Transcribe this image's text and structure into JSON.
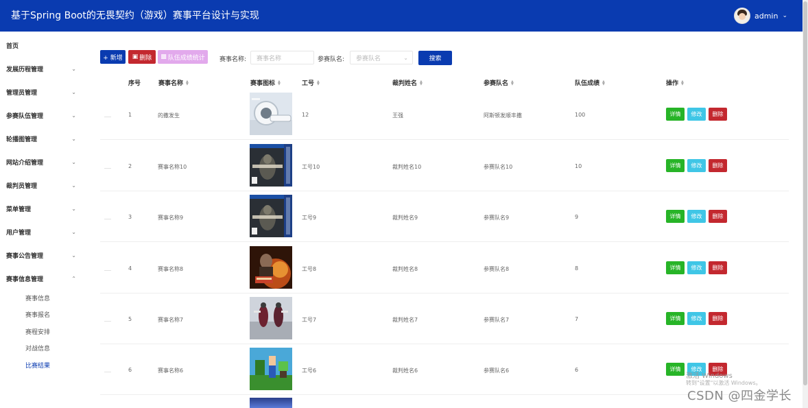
{
  "header": {
    "title": "基于Spring Boot的无畏契约（游戏）赛事平台设计与实现",
    "username": "admin"
  },
  "sidebar": {
    "items": [
      {
        "label": "首页"
      },
      {
        "label": "发展历程管理"
      },
      {
        "label": "管理员管理"
      },
      {
        "label": "参赛队伍管理"
      },
      {
        "label": "轮播图管理"
      },
      {
        "label": "网站介绍管理"
      },
      {
        "label": "裁判员管理"
      },
      {
        "label": "菜单管理"
      },
      {
        "label": "用户管理"
      },
      {
        "label": "赛事公告管理"
      },
      {
        "label": "赛事信息管理"
      }
    ],
    "subitems": [
      {
        "label": "赛事信息"
      },
      {
        "label": "赛事报名"
      },
      {
        "label": "赛程安排"
      },
      {
        "label": "对战信息"
      },
      {
        "label": "比赛结果"
      }
    ]
  },
  "toolbar": {
    "add": "+ 新增",
    "delete": "删除",
    "stats": "队伍成绩统计",
    "event_name_label": "赛事名称:",
    "event_name_placeholder": "赛事名称",
    "team_label": "参赛队名:",
    "team_placeholder": "参赛队名",
    "search": "搜索"
  },
  "table": {
    "headers": [
      "序号",
      "赛事名称",
      "赛事图标",
      "工号",
      "裁判姓名",
      "参赛队名",
      "队伍成绩",
      "操作"
    ],
    "actions": {
      "detail": "详情",
      "edit": "修改",
      "delete": "删除"
    },
    "rows": [
      {
        "no": "1",
        "name": "的撒发生",
        "id": "12",
        "judge": "王强",
        "team": "阿斯顿发顺丰撒",
        "score": "100",
        "img": "mri"
      },
      {
        "no": "2",
        "name": "赛事名称10",
        "id": "工号10",
        "judge": "裁判姓名10",
        "team": "参赛队名10",
        "score": "10",
        "img": "darksouls"
      },
      {
        "no": "3",
        "name": "赛事名称9",
        "id": "工号9",
        "judge": "裁判姓名9",
        "team": "参赛队名9",
        "score": "9",
        "img": "darksouls"
      },
      {
        "no": "4",
        "name": "赛事名称8",
        "id": "工号8",
        "judge": "裁判姓名8",
        "team": "参赛队名8",
        "score": "8",
        "img": "action"
      },
      {
        "no": "5",
        "name": "赛事名称7",
        "id": "工号7",
        "judge": "裁判姓名7",
        "team": "参赛队名7",
        "score": "7",
        "img": "warriors"
      },
      {
        "no": "6",
        "name": "赛事名称6",
        "id": "工号6",
        "judge": "裁判姓名6",
        "team": "参赛队名6",
        "score": "6",
        "img": "minecraft"
      }
    ]
  },
  "watermark": {
    "line1": "激活 Windows",
    "line2": "转到\"设置\"以激活 Windows。",
    "line3": "CSDN @四金学长"
  }
}
